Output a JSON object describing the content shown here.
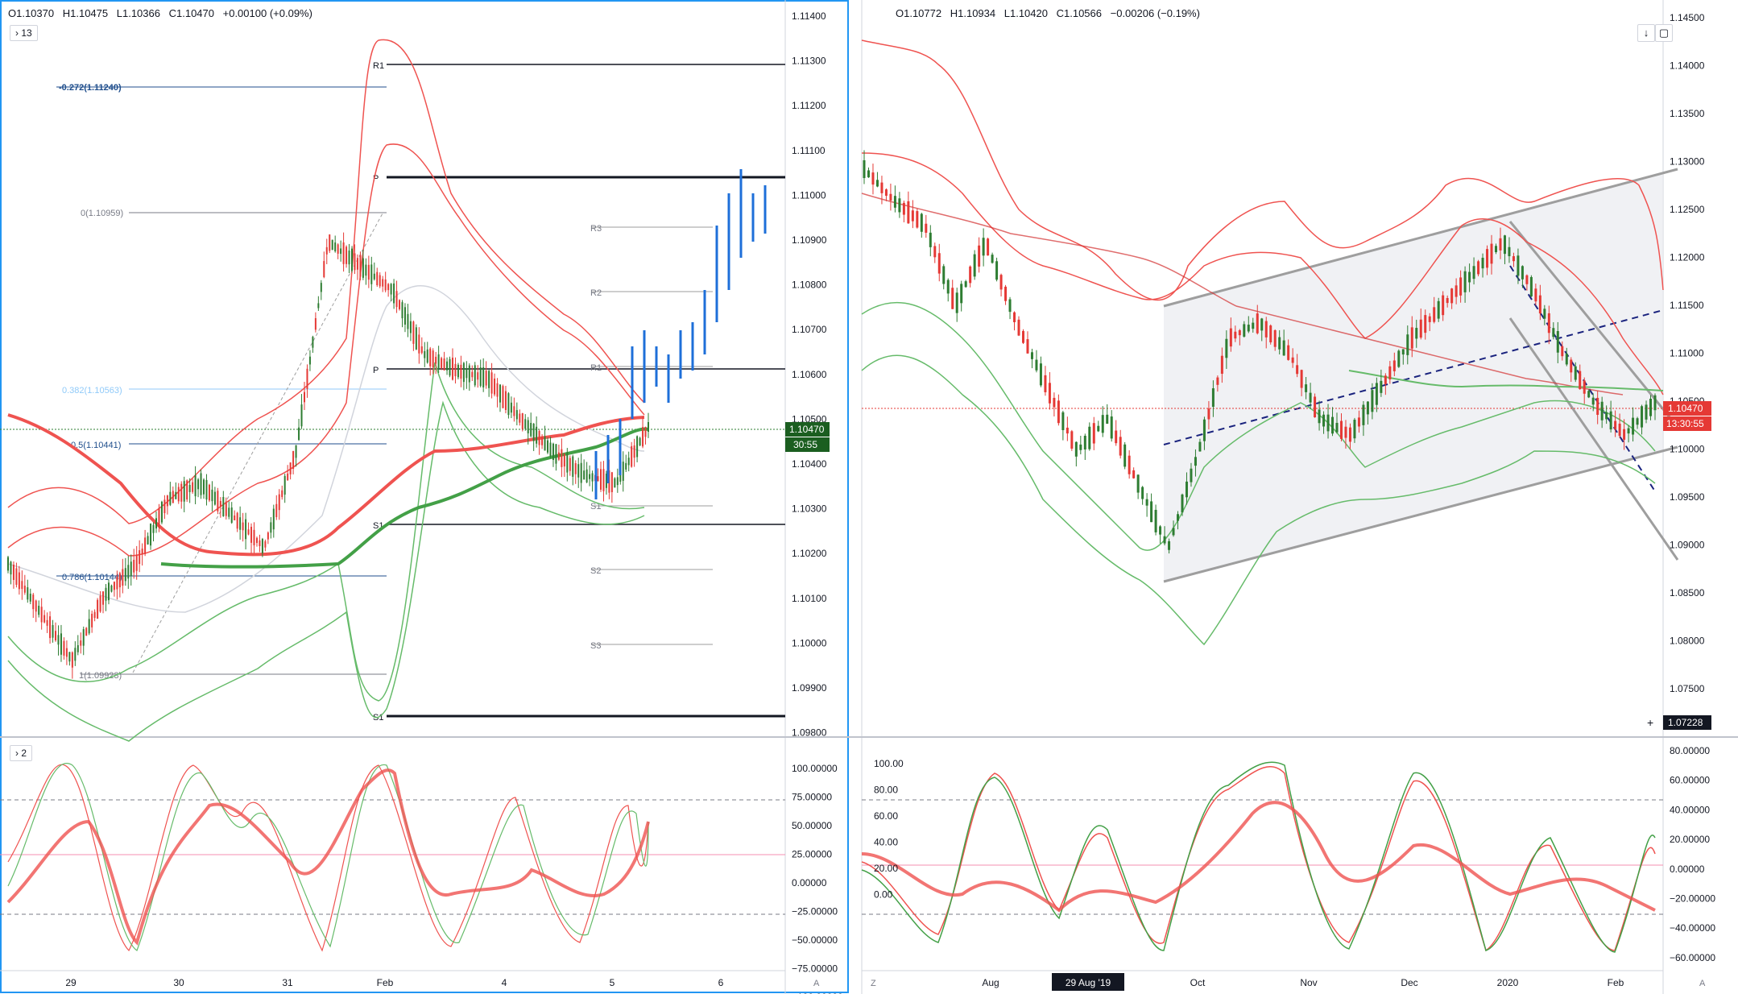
{
  "left_chart": {
    "ohlc": {
      "open": "O1.10370",
      "high": "H1.10475",
      "low": "L1.10366",
      "close": "C1.10470",
      "change": "+0.00100 (+0.09%)"
    },
    "legend_count": "13",
    "price_ticks": [
      "1.11400",
      "1.11300",
      "1.11200",
      "1.11100",
      "1.11000",
      "1.10900",
      "1.10800",
      "1.10700",
      "1.10600",
      "1.10500",
      "1.10400",
      "1.10300",
      "1.10200",
      "1.10100",
      "1.10000",
      "1.09900",
      "1.09800"
    ],
    "x_ticks": [
      "29",
      "30",
      "31",
      "Feb",
      "4",
      "5",
      "6"
    ],
    "price_badge": "1.10470",
    "countdown": "30:55",
    "fib_labels": [
      "-0.272(1.11240)",
      "0(1.10959)",
      "0.382(1.10563)",
      "0.5(1.10441)",
      "0.786(1.10144)",
      "1(1.09923)"
    ],
    "pivot_labels": [
      "R1",
      "P",
      "R3",
      "R2",
      "P",
      "R1",
      "S1",
      "S1",
      "S2",
      "S3",
      "S1"
    ],
    "osc_legend_count": "2",
    "osc_ticks": [
      "100.00000",
      "75.00000",
      "50.00000",
      "25.00000",
      "0.00000",
      "−25.00000",
      "−50.00000",
      "−75.00000",
      "−100.00000"
    ],
    "axis_corner": "A"
  },
  "right_chart": {
    "ohlc": {
      "open": "O1.10772",
      "high": "H1.10934",
      "low": "L1.10420",
      "close": "C1.10566",
      "change": "−0.00206 (−0.19%)"
    },
    "price_ticks": [
      "1.14500",
      "1.14000",
      "1.13500",
      "1.13000",
      "1.12500",
      "1.12000",
      "1.11500",
      "1.11000",
      "1.10500",
      "1.10000",
      "1.09500",
      "1.09000",
      "1.08500",
      "1.08000",
      "1.07500"
    ],
    "x_ticks": [
      "Aug",
      "29 Aug '19",
      "Oct",
      "Nov",
      "Dec",
      "2020",
      "Feb"
    ],
    "price_badge": "1.10470",
    "countdown": "13:30:55",
    "crosshair_price": "1.07228",
    "osc_left_ticks": [
      "100.00",
      "80.00",
      "60.00",
      "40.00",
      "20.00",
      "0.00"
    ],
    "osc_right_ticks": [
      "80.00000",
      "60.00000",
      "40.00000",
      "20.00000",
      "0.00000",
      "−20.00000",
      "−40.00000",
      "−60.00000"
    ],
    "axis_corner": "A",
    "axis_corner_left": "Z"
  },
  "colors": {
    "up": "#2e7d32",
    "down": "#e53935",
    "red_line": "#ef5350",
    "green_line": "#66bb6a",
    "blue": "#1e6fd9",
    "fib": "#1f4e8c",
    "navy": "#1a237e",
    "channel": "#9e9e9e"
  },
  "chart_data": [
    {
      "type": "line",
      "title": "",
      "timeframe_note": "",
      "x": [
        "29",
        "30",
        "31",
        "Feb",
        "4",
        "5",
        "6"
      ],
      "series": [
        {
          "values": [
            1.1015,
            1.1005,
            1.1019,
            1.1089,
            1.1065,
            1.1036,
            1.1047
          ]
        }
      ],
      "ylim": [
        1.0975,
        1.1145
      ],
      "fib_levels": [
        [
          "-0.272",
          1.1124
        ],
        [
          "0",
          1.10959
        ],
        [
          "0.382",
          1.10563
        ],
        [
          "0.5",
          1.10441
        ],
        [
          "0.786",
          1.10144
        ],
        [
          "1",
          1.09923
        ]
      ],
      "current_price": 1.1047,
      "grid": false
    },
    {
      "type": "line",
      "title": "",
      "x": [
        "Aug",
        "29 Aug '19",
        "Oct",
        "Nov",
        "Dec",
        "2020",
        "Feb"
      ],
      "series": [
        {
          "values": [
            1.118,
            1.1,
            1.095,
            1.114,
            1.11,
            1.116,
            1.1047
          ]
        }
      ],
      "ylim": [
        1.071,
        1.146
      ],
      "current_price": 1.1047,
      "grid": false
    }
  ]
}
